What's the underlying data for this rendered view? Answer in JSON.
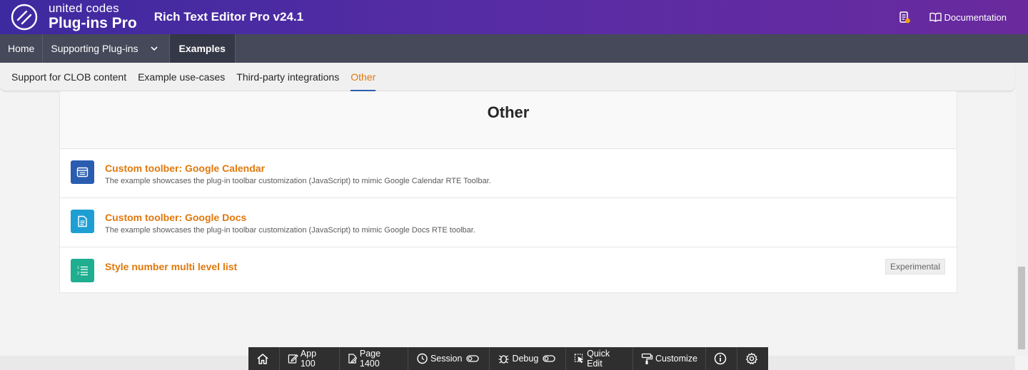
{
  "header": {
    "logo_top": "united codes",
    "logo_bottom": "Plug-ins Pro",
    "app_title": "Rich Text Editor Pro v24.1",
    "documentation_label": "Documentation",
    "icons": {
      "logo": "united-codes-logo",
      "notifications": "clipboard-alert-icon",
      "documentation": "book-open-icon"
    }
  },
  "nav": {
    "items": [
      {
        "label": "Home"
      },
      {
        "label": "Supporting Plug-ins",
        "icon": "chevron-down-icon"
      },
      {
        "label": "Examples",
        "active": true
      }
    ]
  },
  "subtabs": {
    "items": [
      {
        "label": "Support for CLOB content"
      },
      {
        "label": "Example use-cases"
      },
      {
        "label": "Third-party integrations"
      },
      {
        "label": "Other",
        "active": true
      }
    ]
  },
  "main": {
    "title": "Other",
    "items": [
      {
        "title": "Custom toolber: Google Calendar",
        "description": "The example showcases the plug-in toolbar customization (JavaScript) to mimic Google Calendar RTE Toolbar.",
        "icon": "calendar-icon",
        "icon_color": "#2a5db0"
      },
      {
        "title": "Custom toolber: Google Docs",
        "description": "The example showcases the plug-in toolbar customization (JavaScript) to mimic Google Docs RTE toolbar.",
        "icon": "document-icon",
        "icon_color": "#1e9fd4"
      },
      {
        "title": "Style number multi level list",
        "description": "",
        "badge": "Experimental",
        "icon": "numbered-list-icon",
        "icon_color": "#1fae8f"
      }
    ]
  },
  "devbar": {
    "home_icon": "home-icon",
    "app": "App 100",
    "page": "Page 1400",
    "session": "Session",
    "debug": "Debug",
    "quick_edit": "Quick Edit",
    "customize": "Customize",
    "info_icon": "info-icon",
    "settings_icon": "gear-icon"
  },
  "colors": {
    "header_gradient_start": "#3e2aa0",
    "header_gradient_end": "#6a2a9e",
    "nav_bg": "#464959",
    "accent_orange": "#e0780c",
    "active_underline": "#2a5db0"
  }
}
